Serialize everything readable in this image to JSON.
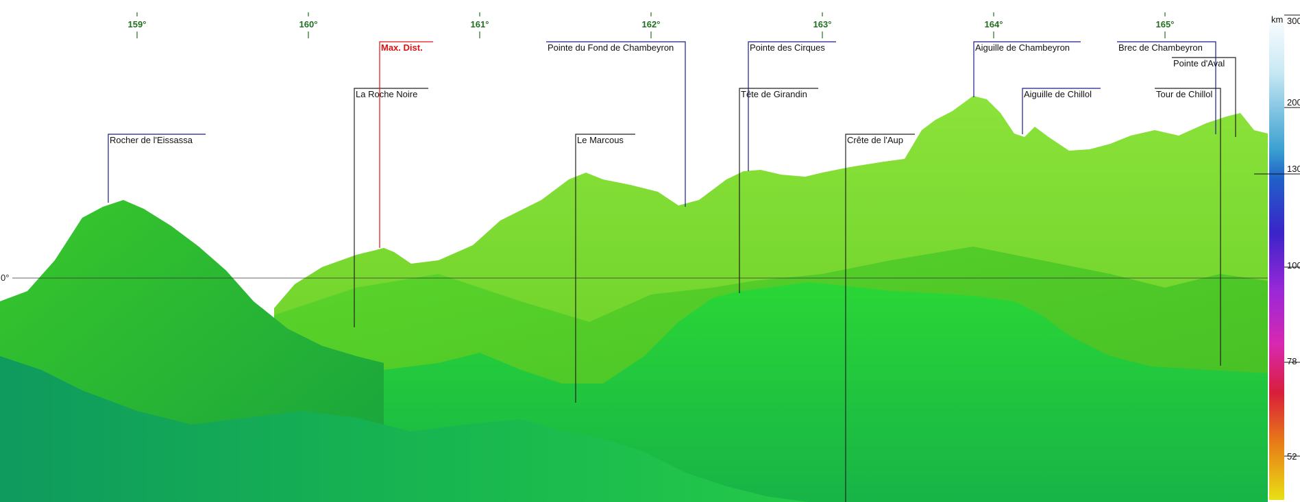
{
  "azimuth_scale": {
    "ticks": [
      "159°",
      "160°",
      "161°",
      "162°",
      "163°",
      "164°",
      "165°"
    ],
    "horizon_label": "0°"
  },
  "peaks": [
    {
      "name": "Rocher de l'Eissassa"
    },
    {
      "name": "La Roche Noire"
    },
    {
      "name": "Max. Dist.",
      "highlight": true
    },
    {
      "name": "Pointe du Fond de Chambeyron"
    },
    {
      "name": "Le Marcous"
    },
    {
      "name": "Pointe des Cirques"
    },
    {
      "name": "Tête de Girandin"
    },
    {
      "name": "Crête de l'Aup"
    },
    {
      "name": "Aiguille de Chambeyron"
    },
    {
      "name": "Aiguille de Chillol"
    },
    {
      "name": "Brec de Chambeyron"
    },
    {
      "name": "Pointe d'Aval"
    },
    {
      "name": "Tour de Chillol"
    }
  ],
  "distance_legend": {
    "unit": "km",
    "labels": [
      "300",
      "200",
      "130",
      "100",
      "78",
      "52"
    ]
  },
  "colors": {
    "peak_line": "#1a1a8c",
    "max_dist": "#e01010",
    "tick": "#1f6f1f",
    "terrain_far": "#6fdc2a",
    "terrain_near": "#1aa64a"
  }
}
